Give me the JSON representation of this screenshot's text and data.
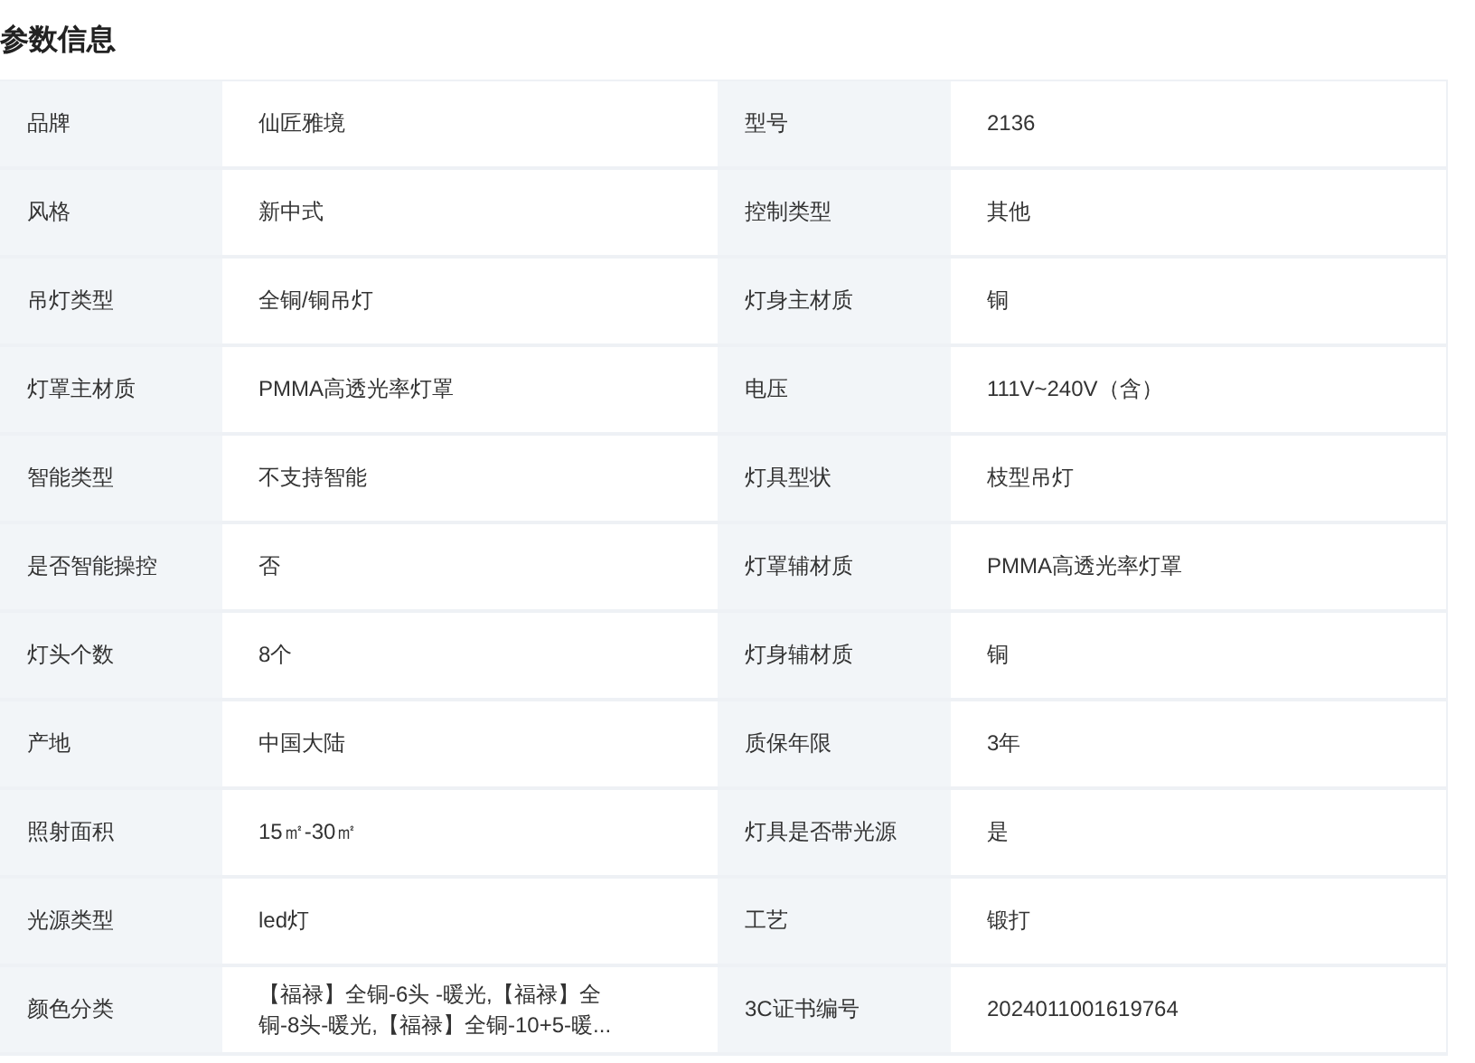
{
  "title": "参数信息",
  "params": [
    {
      "label": "品牌",
      "value": "仙匠雅境"
    },
    {
      "label": "型号",
      "value": "2136"
    },
    {
      "label": "风格",
      "value": "新中式"
    },
    {
      "label": "控制类型",
      "value": "其他"
    },
    {
      "label": "吊灯类型",
      "value": "全铜/铜吊灯"
    },
    {
      "label": "灯身主材质",
      "value": "铜"
    },
    {
      "label": "灯罩主材质",
      "value": "PMMA高透光率灯罩"
    },
    {
      "label": "电压",
      "value": "111V~240V（含）"
    },
    {
      "label": "智能类型",
      "value": "不支持智能"
    },
    {
      "label": "灯具型状",
      "value": "枝型吊灯"
    },
    {
      "label": "是否智能操控",
      "value": "否"
    },
    {
      "label": "灯罩辅材质",
      "value": "PMMA高透光率灯罩"
    },
    {
      "label": "灯头个数",
      "value": "8个"
    },
    {
      "label": "灯身辅材质",
      "value": "铜"
    },
    {
      "label": "产地",
      "value": "中国大陆"
    },
    {
      "label": "质保年限",
      "value": "3年"
    },
    {
      "label": "照射面积",
      "value": "15㎡-30㎡"
    },
    {
      "label": "灯具是否带光源",
      "value": "是"
    },
    {
      "label": "光源类型",
      "value": "led灯"
    },
    {
      "label": "工艺",
      "value": "锻打"
    },
    {
      "label": "颜色分类",
      "value": "【福禄】全铜-6头 -暖光,【福禄】全铜-8头-暖光,【福禄】全铜-10+5-暖..."
    },
    {
      "label": "3C证书编号",
      "value": "2024011001619764"
    }
  ]
}
